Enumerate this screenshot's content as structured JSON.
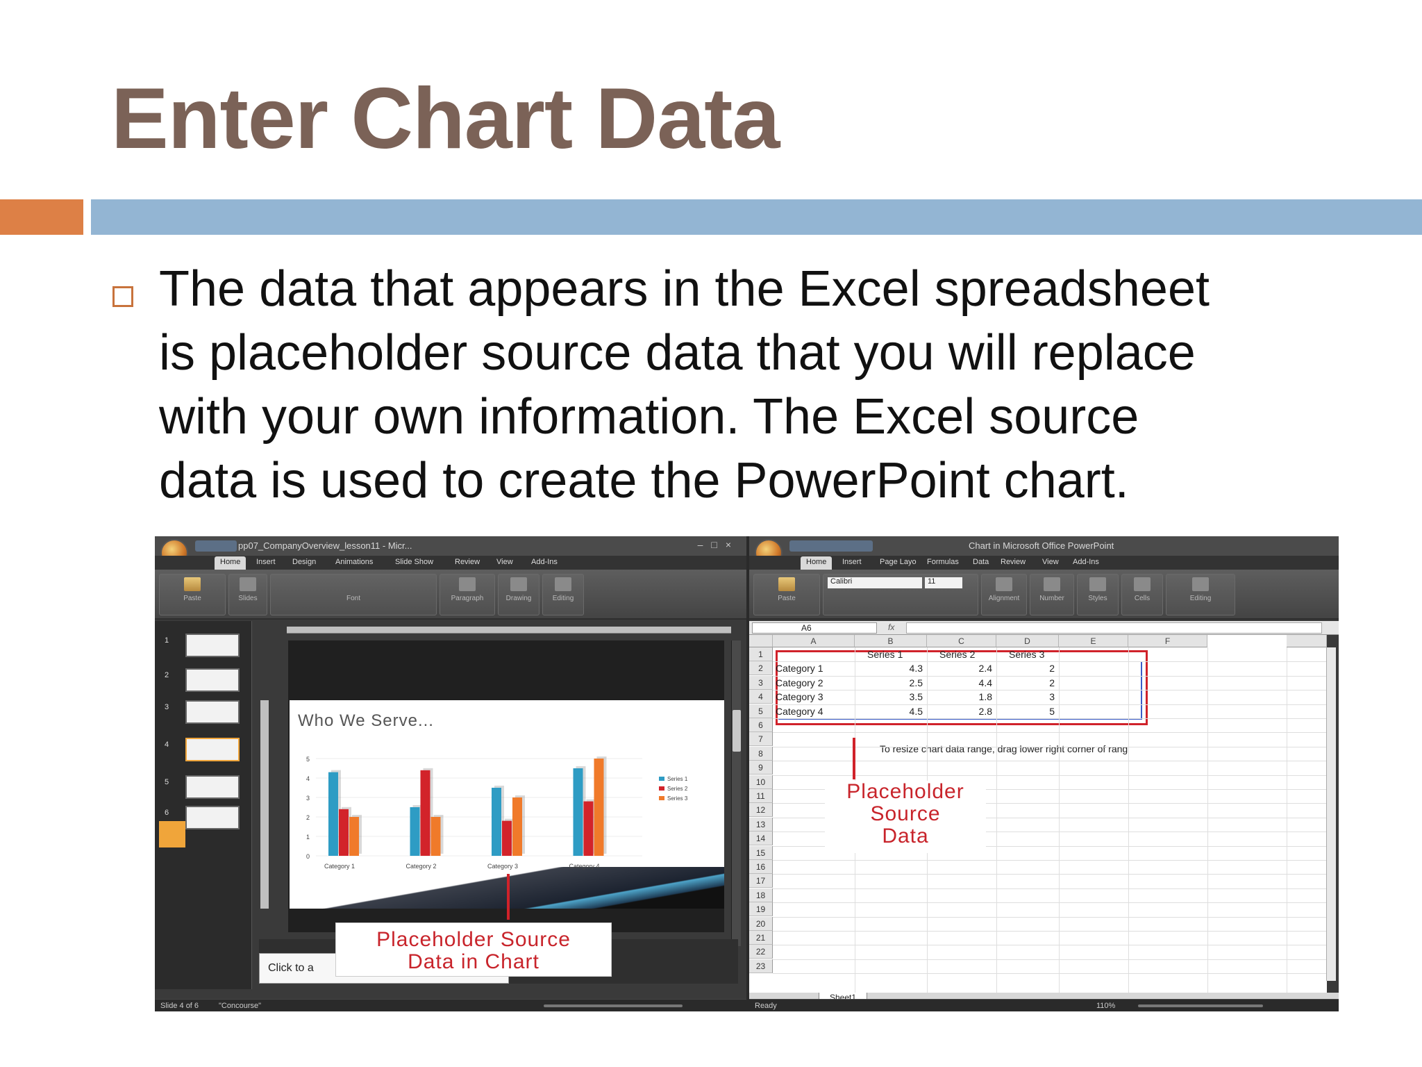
{
  "slide": {
    "title": "Enter Chart Data",
    "bullet": "The data that appears in the Excel spreadsheet is placeholder source data that you will replace with your own information. The Excel source data is used to create the PowerPoint chart."
  },
  "ppt": {
    "window_title": "pp07_CompanyOverview_lesson11 - Micr...",
    "tabs": [
      "Home",
      "Insert",
      "Design",
      "Animations",
      "Slide Show",
      "Review",
      "View",
      "Add-Ins"
    ],
    "groups": [
      "Paste",
      "Slides",
      "Font",
      "Paragraph",
      "Drawing",
      "Editing"
    ],
    "thumb_numbers": [
      "1",
      "2",
      "3",
      "4",
      "5",
      "6"
    ],
    "slide_heading": "Who We Serve...",
    "notes_placeholder": "Click to a",
    "status_slide": "Slide 4 of 6",
    "status_theme": "\"Concourse\""
  },
  "excel": {
    "window_title": "Chart in Microsoft Office PowerPoint",
    "tabs": [
      "Home",
      "Insert",
      "Page Layo",
      "Formulas",
      "Data",
      "Review",
      "View",
      "Add-Ins"
    ],
    "groups": [
      "Paste",
      "Alignment",
      "Number",
      "Styles",
      "Cells",
      "Editing"
    ],
    "font_name": "Calibri",
    "font_size": "11",
    "name_box": "A6",
    "fx": "fx",
    "columns": [
      "A",
      "B",
      "C",
      "D",
      "E",
      "F"
    ],
    "rows": [
      "1",
      "2",
      "3",
      "4",
      "5",
      "6",
      "7",
      "8",
      "9",
      "10",
      "11",
      "12",
      "13",
      "14",
      "15",
      "16",
      "17",
      "18",
      "19",
      "20",
      "21",
      "22",
      "23"
    ],
    "header_row": [
      "",
      "Series 1",
      "Series 2",
      "Series 3"
    ],
    "data_rows": [
      [
        "Category 1",
        "4.3",
        "2.4",
        "2"
      ],
      [
        "Category 2",
        "2.5",
        "4.4",
        "2"
      ],
      [
        "Category 3",
        "3.5",
        "1.8",
        "3"
      ],
      [
        "Category 4",
        "4.5",
        "2.8",
        "5"
      ]
    ],
    "resize_note": "To resize chart data range, drag lower right corner of rang",
    "sheet_tab": "Sheet1",
    "status": "Ready",
    "zoom": "110%"
  },
  "callouts": {
    "excel": [
      "Placeholder",
      "Source",
      "Data"
    ],
    "chart": [
      "Placeholder Source",
      "Data in Chart"
    ]
  },
  "colors": {
    "series1": "#2e9cc4",
    "series2": "#d2232a",
    "series3": "#f07a2a",
    "title": "#7b6257",
    "callout": "#c8242b"
  },
  "chart_data": {
    "type": "bar",
    "categories": [
      "Category 1",
      "Category 2",
      "Category 3",
      "Category 4"
    ],
    "series": [
      {
        "name": "Series 1",
        "values": [
          4.3,
          2.5,
          3.5,
          4.5
        ]
      },
      {
        "name": "Series 2",
        "values": [
          2.4,
          4.4,
          1.8,
          2.8
        ]
      },
      {
        "name": "Series 3",
        "values": [
          2,
          2,
          3,
          5
        ]
      }
    ],
    "yticks": [
      "0",
      "1",
      "2",
      "3",
      "4",
      "5"
    ],
    "ylim": [
      0,
      5
    ],
    "legend": "right"
  }
}
